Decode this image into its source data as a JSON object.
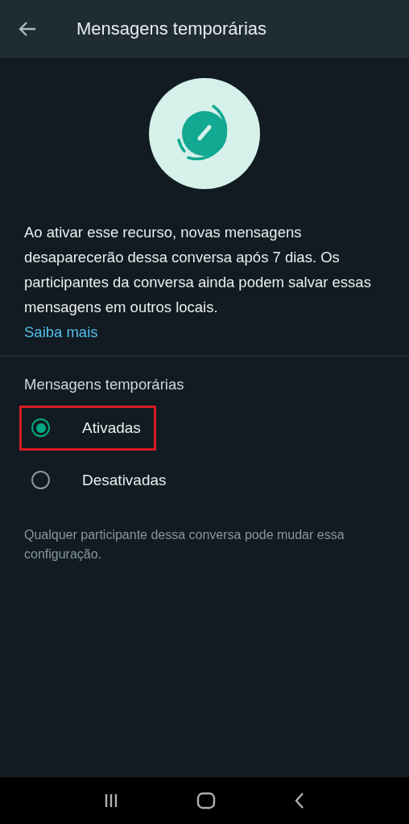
{
  "header": {
    "title": "Mensagens temporárias"
  },
  "description": "Ao ativar esse recurso, novas mensagens desaparecerão dessa conversa após 7 dias. Os participantes da conversa ainda podem salvar essas mensagens em outros locais.",
  "link": "Saiba mais",
  "section_title": "Mensagens temporárias",
  "options": [
    {
      "label": "Ativadas",
      "selected": true,
      "highlighted": true
    },
    {
      "label": "Desativadas",
      "selected": false,
      "highlighted": false
    }
  ],
  "footnote": "Qualquer participante dessa conversa pode mudar essa configuração."
}
